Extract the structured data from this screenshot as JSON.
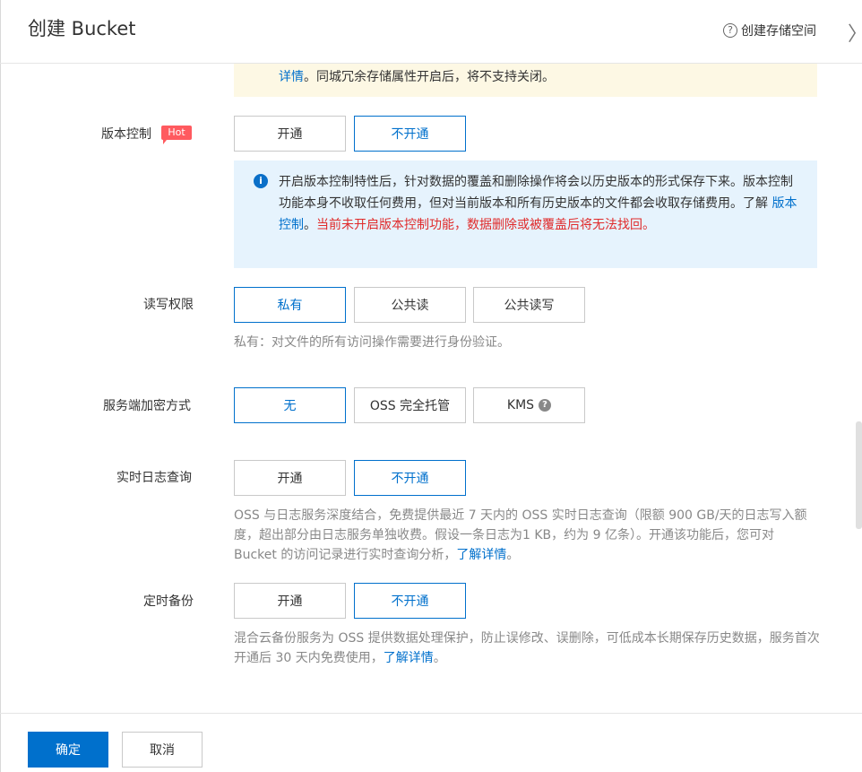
{
  "header": {
    "title": "创建 Bucket",
    "help_icon": "?",
    "help_label": "创建存储空间",
    "close_glyph": "〉"
  },
  "redundancy_notice": {
    "link": "详情",
    "text": "。同城冗余存储属性开启后，将不支持关闭。"
  },
  "versioning": {
    "label": "版本控制",
    "badge": "Hot",
    "options": [
      "开通",
      "不开通"
    ],
    "selected": "不开通",
    "notice": {
      "text1": "开启版本控制特性后，针对数据的覆盖和删除操作将会以历史版本的形式保存下来。版本控制功能本身不收取任何费用，但对当前版本和所有历史版本的文件都会收取存储费用。了解 ",
      "link": "版本控制",
      "text2": "。",
      "warning": "当前未开启版本控制功能，数据删除或被覆盖后将无法找回。"
    }
  },
  "acl": {
    "label": "读写权限",
    "options": [
      "私有",
      "公共读",
      "公共读写"
    ],
    "selected": "私有",
    "desc": "私有：对文件的所有访问操作需要进行身份验证。"
  },
  "encryption": {
    "label": "服务端加密方式",
    "options": [
      "无",
      "OSS 完全托管",
      "KMS"
    ],
    "selected": "无",
    "kms_help": "?"
  },
  "realtime_log": {
    "label": "实时日志查询",
    "options": [
      "开通",
      "不开通"
    ],
    "selected": "不开通",
    "desc": "OSS 与日志服务深度结合，免费提供最近 7 天内的 OSS 实时日志查询（限额 900 GB/天的日志写入额度，超出部分由日志服务单独收费。假设一条日志为1 KB，约为 9 亿条）。开通该功能后，您可对 Bucket 的访问记录进行实时查询分析，",
    "link": "了解详情",
    "tail": "。"
  },
  "backup": {
    "label": "定时备份",
    "options": [
      "开通",
      "不开通"
    ],
    "selected": "不开通",
    "desc": "混合云备份服务为 OSS 提供数据处理保护，防止误修改、误删除，可低成本长期保存历史数据，服务首次开通后 30 天内免费使用，",
    "link": "了解详情",
    "tail": "。"
  },
  "footer": {
    "confirm": "确定",
    "cancel": "取消"
  }
}
